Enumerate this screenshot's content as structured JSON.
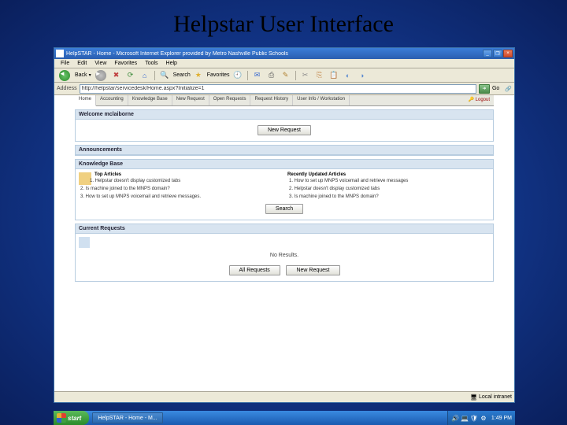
{
  "slide_title": "Helpstar User Interface",
  "window": {
    "title": "HelpSTAR - Home - Microsoft Internet Explorer provided by Metro Nashville Public Schools",
    "min": "_",
    "max": "❐",
    "close": "×"
  },
  "menubar": [
    "File",
    "Edit",
    "View",
    "Favorites",
    "Tools",
    "Help"
  ],
  "toolbar": {
    "back": "Back",
    "search": "Search",
    "favorites": "Favorites"
  },
  "address": {
    "label": "Address",
    "url": "http://helpstar/servicedesk/Home.aspx?Initialize=1",
    "go": "Go"
  },
  "tabs": [
    "Home",
    "Accounting",
    "Knowledge Base",
    "New Request",
    "Open Requests",
    "Request History",
    "User Info / Workstation"
  ],
  "logout": "Logout",
  "welcome": {
    "title": "Welcome mclaiborne"
  },
  "buttons": {
    "new_request": "New Request",
    "search": "Search",
    "all_requests": "All Requests",
    "new_request2": "New Request"
  },
  "panels": {
    "announcements": "Announcements",
    "knowledge_base": "Knowledge Base",
    "current_requests": "Current Requests"
  },
  "kb": {
    "top_hdr": "Top Articles",
    "recent_hdr": "Recently Updated Articles",
    "top": [
      "1. Helpstar doesn't display customized tabs",
      "2. Is machine joined to the MNPS domain?",
      "3. How to set up MNPS voicemail and retrieve messages."
    ],
    "recent": [
      "1. How to set up MNPS voicemail and retrieve messages",
      "2. Helpstar doesn't display customized tabs",
      "3. Is machine joined to the MNPS domain?"
    ]
  },
  "requests": {
    "no_results": "No Results."
  },
  "status": {
    "zone": "Local intranet"
  },
  "taskbar": {
    "start": "start",
    "task1": "HelpSTAR - Home - M...",
    "clock": "1:49 PM"
  }
}
